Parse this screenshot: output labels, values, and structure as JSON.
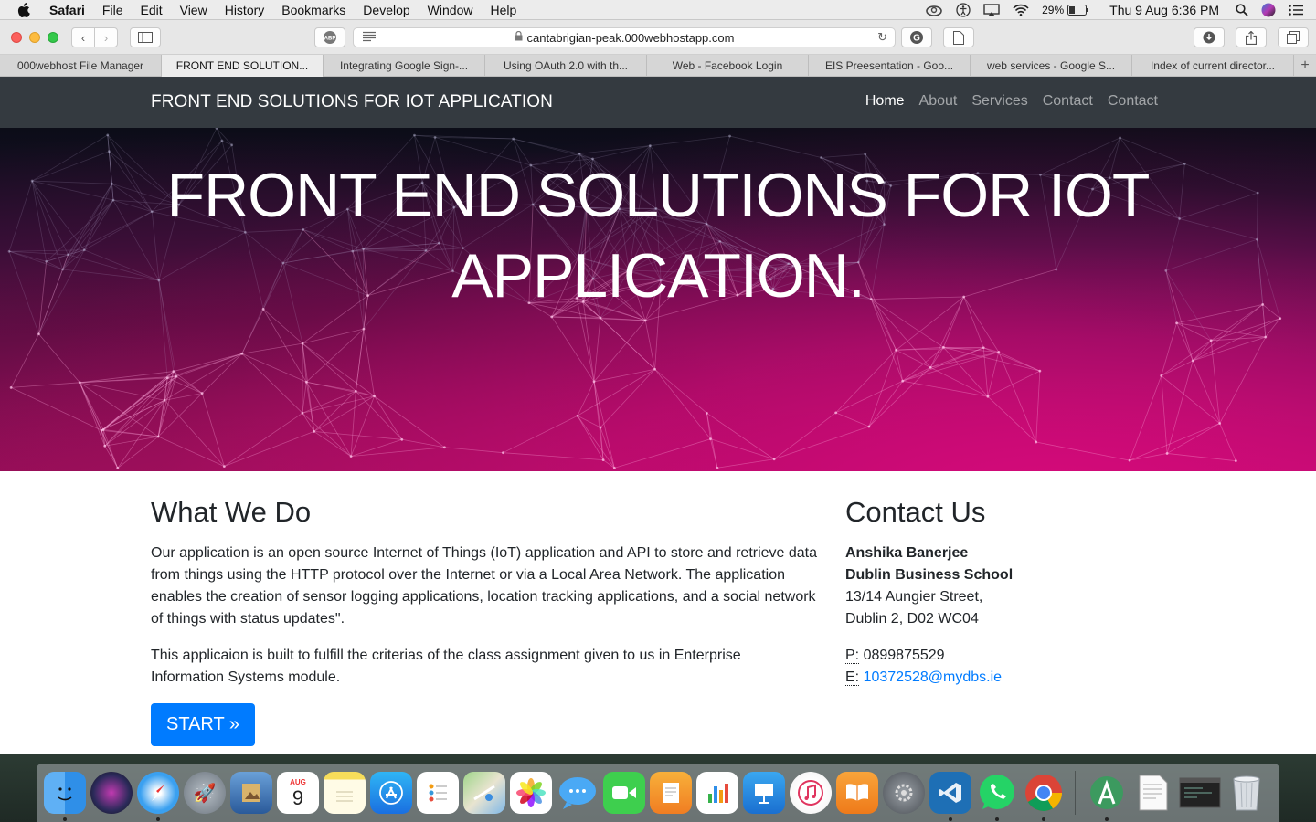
{
  "menubar": {
    "app": "Safari",
    "items": [
      "File",
      "Edit",
      "View",
      "History",
      "Bookmarks",
      "Develop",
      "Window",
      "Help"
    ],
    "battery": "29%",
    "datetime": "Thu 9 Aug  6:36 PM"
  },
  "browser": {
    "url": "cantabrigian-peak.000webhostapp.com",
    "tabs": [
      "000webhost File Manager",
      "FRONT END SOLUTION...",
      "Integrating Google Sign-...",
      "Using OAuth 2.0 with th...",
      "Web - Facebook Login",
      "EIS Preesentation - Goo...",
      "web services - Google S...",
      "Index of current director..."
    ],
    "active_tab": 1
  },
  "site": {
    "brand": "FRONT END SOLUTIONS FOR IOT APPLICATION",
    "nav": [
      "Home",
      "About",
      "Services",
      "Contact",
      "Contact"
    ],
    "hero_title_line1": "FRONT END SOLUTIONS FOR IOT",
    "hero_title_line2": "APPLICATION.",
    "what_we_do": {
      "heading": "What We Do",
      "para1": "Our application is an open source Internet of Things (IoT) application and API to store and retrieve data from things using the HTTP protocol over the Internet or via a Local Area Network. The application enables the creation of sensor logging applications, location tracking applications, and a social network of things with status updates\".",
      "para2": "This applicaion is built to fulfill the criterias of the class assignment given to us in Enterprise Information Systems module.",
      "button": "START »"
    },
    "contact": {
      "heading": "Contact Us",
      "name": "Anshika Banerjee",
      "org": "Dublin Business School",
      "street": "13/14 Aungier Street,",
      "city": "Dublin 2, D02 WC04",
      "phone_label": "P:",
      "phone": "0899875529",
      "email_label": "E:",
      "email": "10372528@mydbs.ie"
    }
  },
  "dock": {
    "apps": [
      "finder-icon",
      "siri-icon",
      "safari-icon",
      "launchpad-icon",
      "preview-icon",
      "calendar-icon",
      "notes-icon",
      "app-store-icon",
      "reminders-icon",
      "maps-icon",
      "photos-icon",
      "messages-icon",
      "facetime-icon",
      "pages-icon",
      "numbers-icon",
      "keynote-icon",
      "itunes-icon",
      "ibooks-icon",
      "system-preferences-icon",
      "vscode-icon",
      "whatsapp-icon",
      "chrome-icon",
      "android-studio-icon",
      "text-file-icon",
      "terminal-window-icon",
      "trash-icon"
    ],
    "calendar_month": "AUG",
    "calendar_day": "9"
  },
  "colors": {
    "navbar_bg": "#343a40",
    "primary": "#007bff",
    "hero_magenta": "#d40a7a"
  }
}
